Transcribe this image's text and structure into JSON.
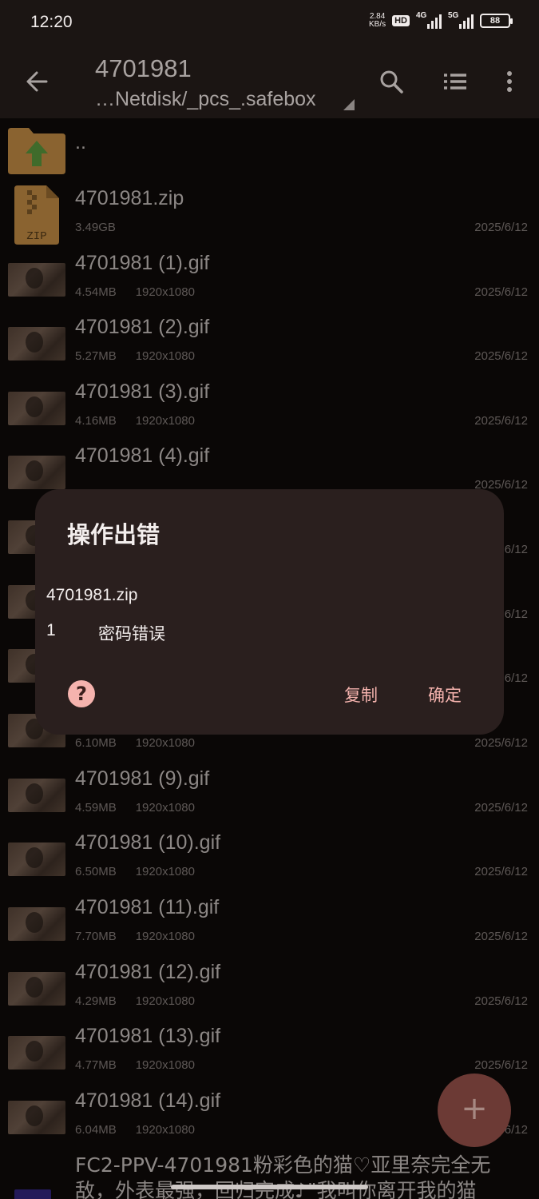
{
  "status_bar": {
    "time": "12:20",
    "speed_value": "2.84",
    "speed_unit": "KB/s",
    "hd_badge": "HD",
    "sim1_label": "4G",
    "sim2_label": "5G",
    "battery": "88"
  },
  "app_bar": {
    "title": "4701981",
    "path": "…Netdisk/_pcs_.safebox",
    "icons": [
      "back-arrow-icon",
      "search-icon",
      "list-view-icon",
      "more-vertical-icon"
    ]
  },
  "files": [
    {
      "name": "..",
      "type": "parent-folder"
    },
    {
      "name": "4701981.zip",
      "size": "3.49GB",
      "dims": "",
      "date": "2025/6/12",
      "type": "zip"
    },
    {
      "name": "4701981 (1).gif",
      "size": "4.54MB",
      "dims": "1920x1080",
      "date": "2025/6/12",
      "type": "gif"
    },
    {
      "name": "4701981 (2).gif",
      "size": "5.27MB",
      "dims": "1920x1080",
      "date": "2025/6/12",
      "type": "gif"
    },
    {
      "name": "4701981 (3).gif",
      "size": "4.16MB",
      "dims": "1920x1080",
      "date": "2025/6/12",
      "type": "gif"
    },
    {
      "name": "4701981 (4).gif",
      "size": "",
      "dims": "",
      "date": "2025/6/12",
      "type": "gif"
    },
    {
      "name": "",
      "size": "",
      "dims": "",
      "date": "6/12",
      "type": "gif"
    },
    {
      "name": "",
      "size": "",
      "dims": "",
      "date": "6/12",
      "type": "gif"
    },
    {
      "name": "",
      "size": "",
      "dims": "",
      "date": "6/12",
      "type": "gif"
    },
    {
      "name": "",
      "size": "6.10MB",
      "dims": "1920x1080",
      "date": "2025/6/12",
      "type": "gif"
    },
    {
      "name": "4701981 (9).gif",
      "size": "4.59MB",
      "dims": "1920x1080",
      "date": "2025/6/12",
      "type": "gif"
    },
    {
      "name": "4701981 (10).gif",
      "size": "6.50MB",
      "dims": "1920x1080",
      "date": "2025/6/12",
      "type": "gif"
    },
    {
      "name": "4701981 (11).gif",
      "size": "7.70MB",
      "dims": "1920x1080",
      "date": "2025/6/12",
      "type": "gif"
    },
    {
      "name": "4701981 (12).gif",
      "size": "4.29MB",
      "dims": "1920x1080",
      "date": "2025/6/12",
      "type": "gif"
    },
    {
      "name": "4701981 (13).gif",
      "size": "4.77MB",
      "dims": "1920x1080",
      "date": "2025/6/12",
      "type": "gif"
    },
    {
      "name": "4701981 (14).gif",
      "size": "6.04MB",
      "dims": "1920x1080",
      "date": "6/12",
      "type": "gif"
    }
  ],
  "long_item": {
    "line1": "FC2-PPV-4701981粉彩色的猫♡亚里奈完全无",
    "line2": "敌，外表最强，回归完成♪\"我叫你离开我的猫"
  },
  "dialog": {
    "title": "操作出错",
    "file": "4701981.zip",
    "error_code": "1",
    "error_message": "密码错误",
    "help_icon": "help-icon",
    "copy_label": "复制",
    "ok_label": "确定"
  },
  "fab": {
    "label": "+"
  },
  "colors": {
    "accent": "#f5b3ae",
    "dialog_bg": "#2a1f1e",
    "appbar_bg": "#1b1513",
    "screen_bg": "#0a0706"
  }
}
